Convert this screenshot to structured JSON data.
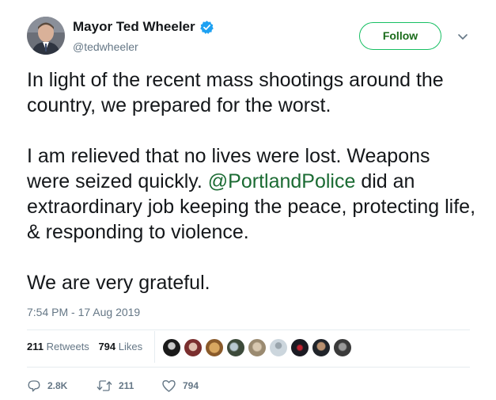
{
  "header": {
    "display_name": "Mayor Ted Wheeler",
    "handle": "@tedwheeler",
    "follow_label": "Follow"
  },
  "body": {
    "paragraph1": "In light of the recent mass shootings around the country, we prepared for the worst.",
    "paragraph2_pre": "I am relieved that no lives were lost. Weapons were seized quickly. ",
    "mention": "@PortlandPolice",
    "paragraph2_post": " did an extraordinary job keeping the peace, protecting life, & responding to violence.",
    "paragraph3": "We are very grateful."
  },
  "timestamp": "7:54 PM - 17 Aug 2019",
  "stats": {
    "retweets_count": "211",
    "retweets_label": "Retweets",
    "likes_count": "794",
    "likes_label": "Likes"
  },
  "actions": {
    "replies": "2.8K",
    "retweets": "211",
    "likes": "794"
  },
  "colors": {
    "follow_border": "#17bf63",
    "mention": "#1b6b33",
    "verified": "#1da1f2",
    "secondary_text": "#657786"
  },
  "icons": {
    "verified": "verified-badge-icon",
    "caret": "chevron-down-icon",
    "reply": "reply-icon",
    "retweet": "retweet-icon",
    "like": "heart-icon"
  }
}
